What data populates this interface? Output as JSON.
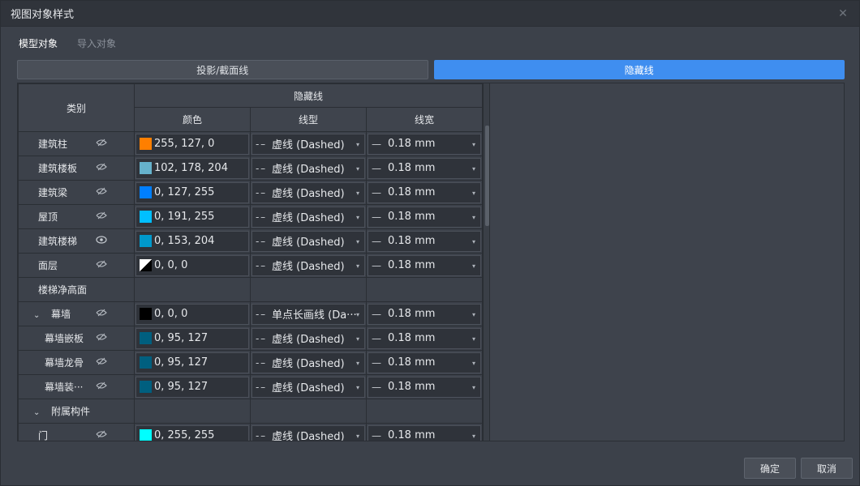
{
  "window": {
    "title": "视图对象样式"
  },
  "subtabs": [
    {
      "label": "模型对象"
    },
    {
      "label": "导入对象"
    }
  ],
  "segments": [
    {
      "label": "投影/截面线"
    },
    {
      "label": "隐藏线"
    }
  ],
  "table": {
    "header_category": "类别",
    "header_group": "隐藏线",
    "header_color": "颜色",
    "header_linetype": "线型",
    "header_linewidth": "线宽",
    "rows": [
      {
        "name": "建筑柱",
        "color_text": "255, 127, 0",
        "swatch": "#ff7f00",
        "linetype": "虚线 (Dashed)",
        "linewidth": "0.18 mm"
      },
      {
        "name": "建筑楼板",
        "color_text": "102, 178, 204",
        "swatch": "#66b2cc",
        "linetype": "虚线 (Dashed)",
        "linewidth": "0.18 mm"
      },
      {
        "name": "建筑梁",
        "color_text": "0, 127, 255",
        "swatch": "#007fff",
        "linetype": "虚线 (Dashed)",
        "linewidth": "0.18 mm"
      },
      {
        "name": "屋顶",
        "color_text": "0, 191, 255",
        "swatch": "#00bfff",
        "linetype": "虚线 (Dashed)",
        "linewidth": "0.18 mm"
      },
      {
        "name": "建筑楼梯",
        "color_text": "0, 153, 204",
        "swatch": "#0099cc",
        "linetype": "虚线 (Dashed)",
        "linewidth": "0.18 mm"
      },
      {
        "name": "面层",
        "color_text": "0, 0, 0",
        "swatch": "bw",
        "linetype": "虚线 (Dashed)",
        "linewidth": "0.18 mm"
      },
      {
        "name": "楼梯净高面"
      },
      {
        "name": "幕墙",
        "color_text": "0, 0, 0",
        "swatch": "#000000",
        "linetype": "单点长画线 (Da···",
        "linewidth": "0.18 mm"
      },
      {
        "name": "幕墙嵌板",
        "color_text": "0, 95, 127",
        "swatch": "#005f7f",
        "linetype": "虚线 (Dashed)",
        "linewidth": "0.18 mm"
      },
      {
        "name": "幕墙龙骨",
        "color_text": "0, 95, 127",
        "swatch": "#005f7f",
        "linetype": "虚线 (Dashed)",
        "linewidth": "0.18 mm"
      },
      {
        "name": "幕墙装···",
        "color_text": "0, 95, 127",
        "swatch": "#005f7f",
        "linetype": "虚线 (Dashed)",
        "linewidth": "0.18 mm"
      },
      {
        "name": "附属构件"
      },
      {
        "name": "门",
        "color_text": "0, 255, 255",
        "swatch": "#00ffff",
        "linetype": "虚线 (Dashed)",
        "linewidth": "0.18 mm"
      }
    ]
  },
  "icons": {
    "eye_hidden": "eye-off-icon",
    "eye_visible": "eye-icon",
    "chevron": "chevron-down-icon",
    "close": "close-icon"
  },
  "buttons": {
    "ok": "确定",
    "cancel": "取消"
  },
  "colors": {
    "accent": "#3f8ef0",
    "background": "#3c414a"
  }
}
